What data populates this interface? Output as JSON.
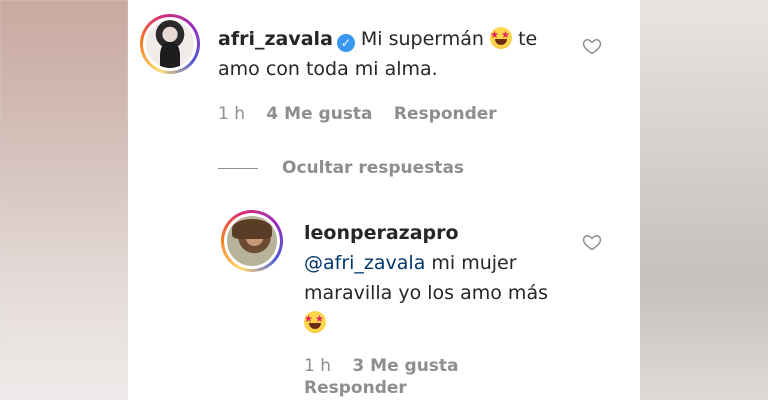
{
  "comment": {
    "username": "afri_zavala",
    "text_line1": "Mi supermán",
    "text_line1_after": "te",
    "text_line2": "amo con toda mi alma.",
    "time": "1 h",
    "likes": "4 Me gusta",
    "reply_label": "Responder",
    "emoji": "star-struck-emoji"
  },
  "replies_toggle": "Ocultar respuestas",
  "reply": {
    "username": "leonperazapro",
    "mention": "@afri_zavala",
    "text_line1_after": " mi mujer",
    "text_line2": "maravilla yo los amo más",
    "time": "1 h",
    "likes": "3 Me gusta",
    "reply_label": "Responder",
    "emoji": "star-struck-emoji"
  },
  "colors": {
    "verified": "#3897f0",
    "mention": "#00376b",
    "meta": "#8e8e8e",
    "text": "#262626"
  }
}
